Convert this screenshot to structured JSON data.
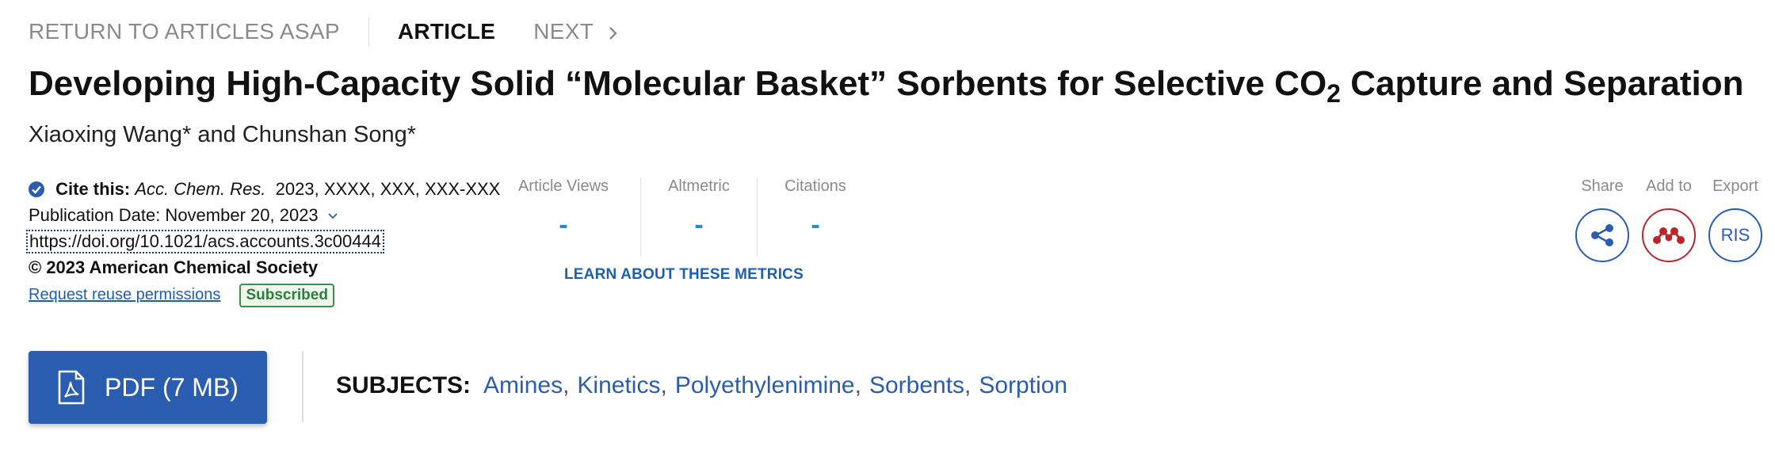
{
  "nav": {
    "return_label": "RETURN TO ARTICLES ASAP",
    "current_label": "ARTICLE",
    "next_label": "NEXT"
  },
  "article": {
    "title_part1": "Developing High-Capacity Solid “Molecular Basket” Sorbents for Selective CO",
    "title_sub": "2",
    "title_part2": " Capture and Separation",
    "authors": "Xiaoxing Wang* and Chunshan Song*"
  },
  "citation": {
    "cite_label": "Cite this:",
    "journal": "Acc. Chem. Res.",
    "ref": "2023, XXXX, XXX, XXX-XXX",
    "pub_date": "Publication Date: November 20, 2023",
    "doi": "https://doi.org/10.1021/acs.accounts.3c00444",
    "copyright": "© 2023 American Chemical Society",
    "reuse_link": "Request reuse permissions",
    "access_badge": "Subscribed"
  },
  "metrics": {
    "views_label": "Article Views",
    "views_value": "-",
    "altmetric_label": "Altmetric",
    "altmetric_value": "-",
    "citations_label": "Citations",
    "citations_value": "-",
    "learn_link": "LEARN ABOUT THESE METRICS"
  },
  "tools": {
    "share_label": "Share",
    "add_label": "Add to",
    "export_label": "Export",
    "export_button": "RIS"
  },
  "actions": {
    "pdf_label": "PDF (7 MB)"
  },
  "subjects": {
    "label": "SUBJECTS:",
    "items": [
      "Amines",
      "Kinetics",
      "Polyethylenimine",
      "Sorbents",
      "Sorption"
    ]
  },
  "colors": {
    "brand_blue": "#2a5db0",
    "metric_blue": "#1e8fd6",
    "mendeley_red": "#b5282e",
    "subscribed_green": "#2e7d3a"
  },
  "icons": [
    "chevron-right-icon",
    "check-circle-icon",
    "chevron-down-icon",
    "share-icon",
    "mendeley-icon",
    "pdf-icon"
  ]
}
